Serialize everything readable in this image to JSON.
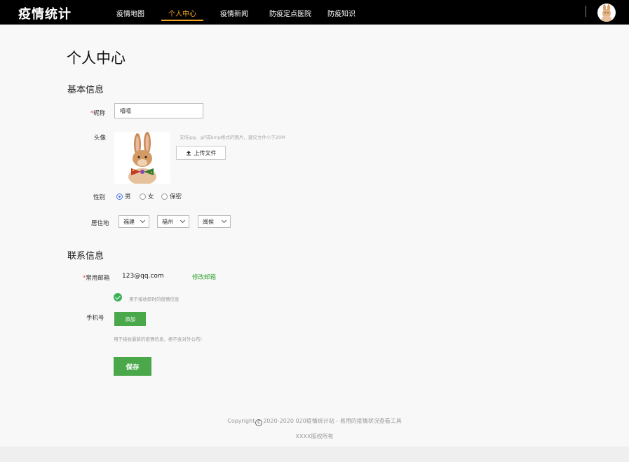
{
  "header": {
    "logo": "疫情统计",
    "nav": [
      "疫情地图",
      "个人中心",
      "疫情新闻",
      "防疫定点医院",
      "防疫知识"
    ],
    "active_index": 1
  },
  "page": {
    "title": "个人中心",
    "basic_section": "基本信息",
    "contact_section": "联系信息"
  },
  "basic": {
    "nickname_required": "*",
    "nickname_label": "昵称",
    "nickname_value": "嘻嘻",
    "avatar_label": "头像",
    "avatar_hint": "支持jpg、gif或bmp格式的图片，建议文件小于20M",
    "upload_label": "上传文件",
    "gender_label": "性别",
    "gender_options": [
      "男",
      "女",
      "保密"
    ],
    "gender_selected": "男",
    "residence_label": "居住地",
    "province": "福建",
    "city": "福州",
    "district": "闽侯"
  },
  "contact": {
    "email_required": "*",
    "email_label": "常用邮箱",
    "email_value": "123@qq.com",
    "edit_email": "修改邮箱",
    "email_note": "用于接收即时的疫情信息",
    "phone_label": "手机号",
    "add_label": "添加",
    "phone_note": "用于接收最新的疫情信息，绝不会对外公布!",
    "save_label": "保存"
  },
  "footer": {
    "copyright_prefix": "Copyright",
    "copyright_symbol": "C",
    "copyright_text": "2020-2020 020疫情统计站 - 易用的疫情状况查看工具",
    "rights": "XXXX版权所有"
  },
  "colors": {
    "accent": "#f5a623",
    "primary_green": "#4aa84a",
    "radio_blue": "#4a6fe3"
  }
}
